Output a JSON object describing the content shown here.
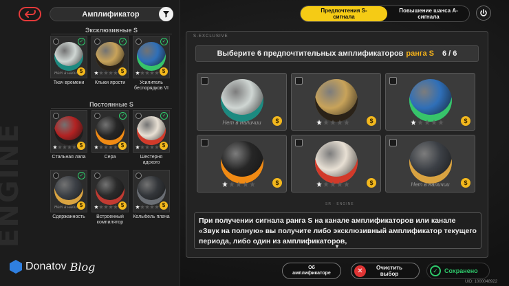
{
  "sidebar": {
    "vertical_text": "ENGINE",
    "title": "Амплификатор",
    "section_exclusive": "Эксклюзивные S",
    "section_permanent": "Постоянные S",
    "exclusive_cards": [
      {
        "name": "Ткач времени",
        "na_label": "Нет в наличии",
        "stars": 0,
        "checked": true,
        "orb": "#cfd6d3",
        "accent": "#1c8a80"
      },
      {
        "name": "Клыки ярости",
        "na_label": "",
        "stars": 1,
        "checked": true,
        "orb": "#c8a35a",
        "accent": "#2a2218"
      },
      {
        "name": "Усилитель беспорядков VI",
        "na_label": "",
        "stars": 1,
        "checked": true,
        "orb": "#2f6fb8",
        "accent": "#37c46a"
      }
    ],
    "permanent_cards": [
      {
        "name": "Стальная лапа",
        "na_label": "",
        "stars": 1,
        "checked": false,
        "orb": "#b22222",
        "accent": "#1e1e1e"
      },
      {
        "name": "Сера",
        "na_label": "",
        "stars": 1,
        "checked": true,
        "orb": "#262626",
        "accent": "#f08a14"
      },
      {
        "name": "Шестерня адского",
        "na_label": "",
        "stars": 1,
        "checked": true,
        "orb": "#e8e0d4",
        "accent": "#d23a2a"
      },
      {
        "name": "Сдержанность",
        "na_label": "Нет в наличии",
        "stars": 0,
        "checked": true,
        "orb": "#3c4046",
        "accent": "#d9a341"
      },
      {
        "name": "Встроенный компилятор",
        "na_label": "",
        "stars": 1,
        "checked": false,
        "orb": "#2a2a2a",
        "accent": "#c13b32"
      },
      {
        "name": "Колыбель плача",
        "na_label": "",
        "stars": 1,
        "checked": false,
        "orb": "#33363a",
        "accent": "#6a6e74"
      }
    ]
  },
  "watermark": {
    "brand": "Donatov",
    "suffix": "Blog"
  },
  "tabs": {
    "active": "Предпочтения S-сигнала",
    "inactive": "Повышение шанса A-сигнала"
  },
  "panel": {
    "tag": "S-EXCLUSIVE",
    "header_prefix": "Выберите 6 предпочтительных амплификаторов",
    "header_rank": "ранга S",
    "header_count": "6 / 6",
    "foot_tag": "SR · ENGINE",
    "selected": [
      {
        "na_label": "Нет в наличии",
        "stars": 0,
        "orb": "#cfd6d3",
        "accent": "#1c8a80"
      },
      {
        "na_label": "",
        "stars": 1,
        "orb": "#c8a35a",
        "accent": "#2a2218"
      },
      {
        "na_label": "",
        "stars": 1,
        "orb": "#2f6fb8",
        "accent": "#37c46a"
      },
      {
        "na_label": "",
        "stars": 1,
        "orb": "#262626",
        "accent": "#f08a14"
      },
      {
        "na_label": "",
        "stars": 1,
        "orb": "#e8e0d4",
        "accent": "#d23a2a"
      },
      {
        "na_label": "Нет в наличии",
        "stars": 0,
        "orb": "#3c4046",
        "accent": "#d9a341"
      }
    ]
  },
  "info_text": "При получении сигнала ранга S на канале амплификаторов или канале «Звук на полную» вы получите либо эксклюзивный амплификатор текущего периода, либо один из амплификаторов,",
  "buttons": {
    "about": "Об амплификаторе",
    "clear": "Очистить выбор",
    "saved": "Сохранено"
  },
  "uid": "UID: 1000048922",
  "colors": {
    "accent": "#f5cb15",
    "rank": "#f5b21a",
    "ok": "#2ec96b",
    "danger": "#e03434"
  }
}
